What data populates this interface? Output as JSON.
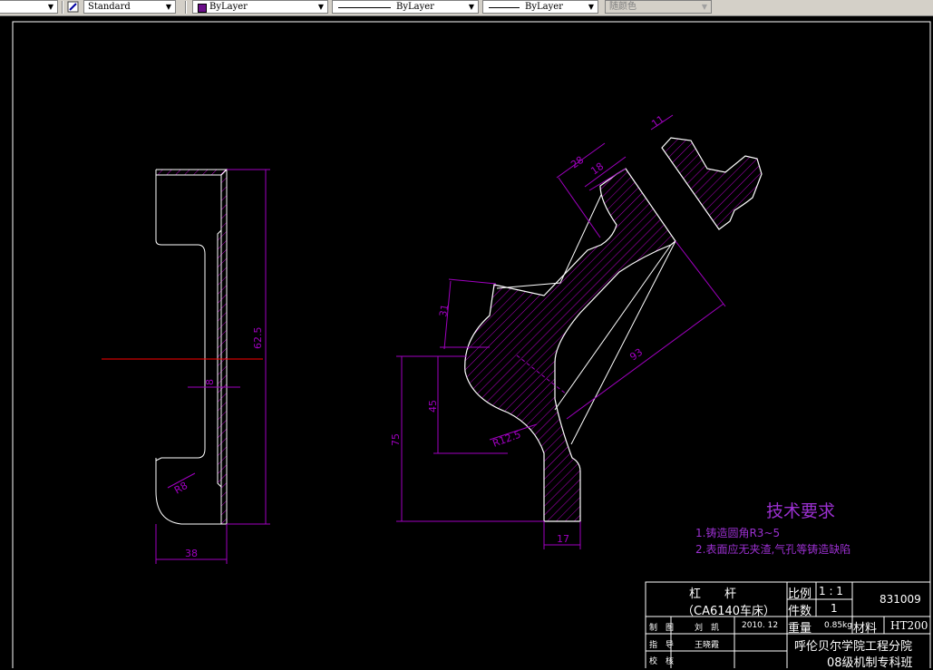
{
  "toolbar": {
    "text_style": "Standard",
    "color": "ByLayer",
    "linetype": "ByLayer",
    "lineweight": "ByLayer",
    "plot_style": "随颜色",
    "color_swatch": "#6b0f8a"
  },
  "drawing": {
    "dims": {
      "height_total": "62.5",
      "width_left": "38",
      "small_8": "8",
      "radius_left": "R8",
      "top_28": "28",
      "top_18": "18",
      "top_11": "11",
      "d31": "31",
      "d93": "93",
      "d45": "45",
      "d75": "75",
      "r12": "R12.5",
      "d17": "17"
    },
    "notes": {
      "heading": "技术要求",
      "line1": "1.铸造圆角R3~5",
      "line2": "2.表面应无夹渣,气孔等铸造缺陷"
    },
    "title_block": {
      "part_name": "杠　　杆",
      "machine": "（CA6140车床）",
      "scale_label": "比例",
      "scale_value": "1 : 1",
      "qty_label": "件数",
      "qty_value": "1",
      "drawing_no": "831009",
      "weight_label": "重量",
      "weight_value": "0.85kg",
      "material_label": "材料",
      "material_value": "HT200",
      "drawn_label": "制　图",
      "drawn_by": "刘　凯",
      "date": "2010. 12",
      "guide_label": "指　导",
      "guide_by": "王晓霞",
      "check_label": "校　核",
      "school": "呼伦贝尔学院工程分院",
      "class": "08级机制专科班"
    }
  },
  "colors": {
    "dimension": "#a000c0",
    "outline": "#ffffff",
    "center_line": "#ff0000",
    "hatch": "#b000c0",
    "notes": "#9b30d0"
  }
}
